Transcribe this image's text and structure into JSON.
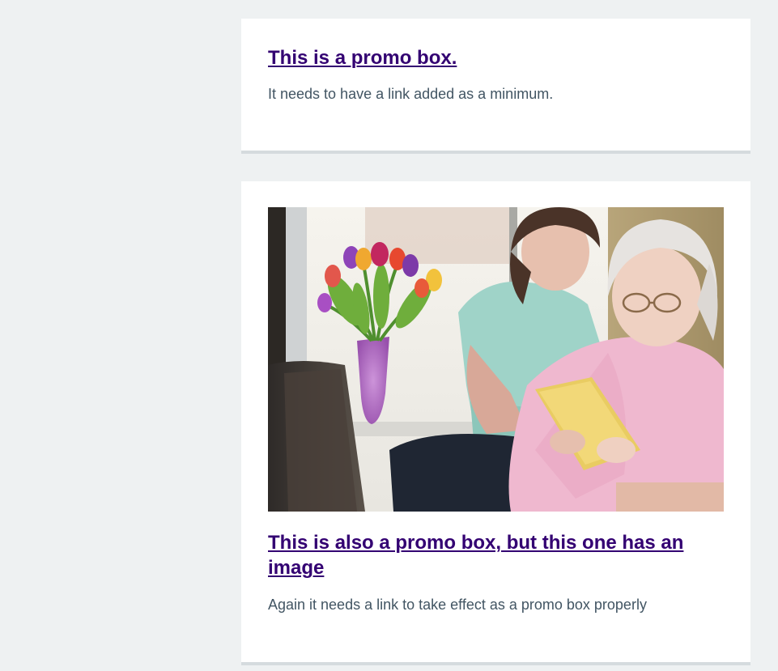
{
  "promos": [
    {
      "title": "This is a promo box.",
      "description": "It needs to have a link added as a minimum."
    },
    {
      "title": "This is also a promo box, but this one has an image",
      "description": "Again it needs a link to take effect as a promo box properly",
      "image_subject": "nurse-and-elderly-woman-with-tablet"
    }
  ],
  "colors": {
    "page_background": "#eef1f2",
    "card_background": "#ffffff",
    "card_border": "#d5dbde",
    "link": "#330072",
    "body_text": "#425563"
  }
}
